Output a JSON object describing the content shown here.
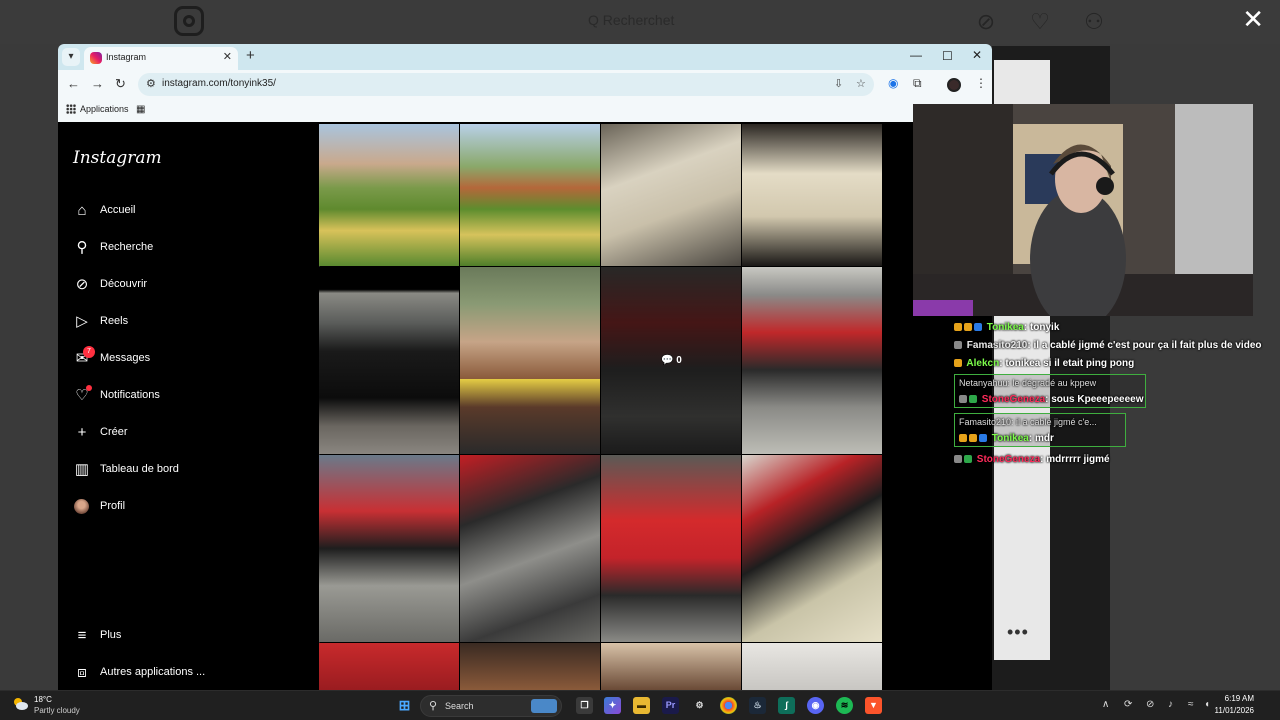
{
  "background": {
    "search_placeholder": "Q Recherchet",
    "close_glyph": "✕"
  },
  "browser": {
    "tab_title": "Instagram",
    "url": "instagram.com/tonyink35/",
    "bookmarks_label": "Applications"
  },
  "instagram": {
    "logo": "Instagram",
    "nav": [
      {
        "label": "Accueil",
        "icon": "home-icon"
      },
      {
        "label": "Recherche",
        "icon": "search-icon"
      },
      {
        "label": "Découvrir",
        "icon": "compass-icon"
      },
      {
        "label": "Reels",
        "icon": "reels-icon"
      },
      {
        "label": "Messages",
        "icon": "messenger-icon",
        "badge": "7"
      },
      {
        "label": "Notifications",
        "icon": "heart-icon"
      },
      {
        "label": "Créer",
        "icon": "plus-icon"
      },
      {
        "label": "Tableau de bord",
        "icon": "dashboard-icon"
      },
      {
        "label": "Profil",
        "icon": "avatar-icon"
      },
      {
        "label": "Plus",
        "icon": "menu-icon"
      },
      {
        "label": "Autres applications ...",
        "icon": "apps-icon"
      }
    ],
    "posts": [
      {
        "subject": "garden-and-bridge"
      },
      {
        "subject": "garden-and-bridge"
      },
      {
        "subject": "car-interior"
      },
      {
        "subject": "van-interior"
      },
      {
        "subject": "black-car"
      },
      {
        "subject": "man-standing"
      },
      {
        "subject": "selfie-sunglasses"
      },
      {
        "subject": "motorcycle-dark",
        "comments": "0"
      },
      {
        "subject": "red-motorcycle"
      },
      {
        "subject": "red-motorcycle"
      },
      {
        "subject": "motorcycle-engine"
      },
      {
        "subject": "motorcycle-tank"
      },
      {
        "subject": "motorcycle-detail"
      }
    ]
  },
  "chat": [
    {
      "user": "Tonikea",
      "user_color": "#7CFC4A",
      "message": "tonyik"
    },
    {
      "user": "Famasito210",
      "user_color": "#E8E8E8",
      "message": "il a cablé jigmé c'est pour ça il fait plus de video"
    },
    {
      "user": "Alekcn",
      "user_color": "#7CFC4A",
      "message": "tonikea si il etait ping pong"
    },
    {
      "reply_to": "Netanyahuu: le dégradé au kppew",
      "user": "StoneGeneza",
      "user_color": "#FF2A5A",
      "message": "sous Kpeeepeeeew"
    },
    {
      "reply_to": "Famasito210: il a cablé jigmé c'e...",
      "user": "Tonikea",
      "user_color": "#7CFC4A",
      "message": "mdr"
    },
    {
      "user": "StoneGeneza",
      "user_color": "#FF2A5A",
      "message": "mdrrrrr jigmé"
    }
  ],
  "taskbar": {
    "weather_temp": "18°C",
    "weather_desc": "Partly cloudy",
    "search_label": "Search",
    "time": "6:19 AM",
    "date": "11/01/2026"
  }
}
